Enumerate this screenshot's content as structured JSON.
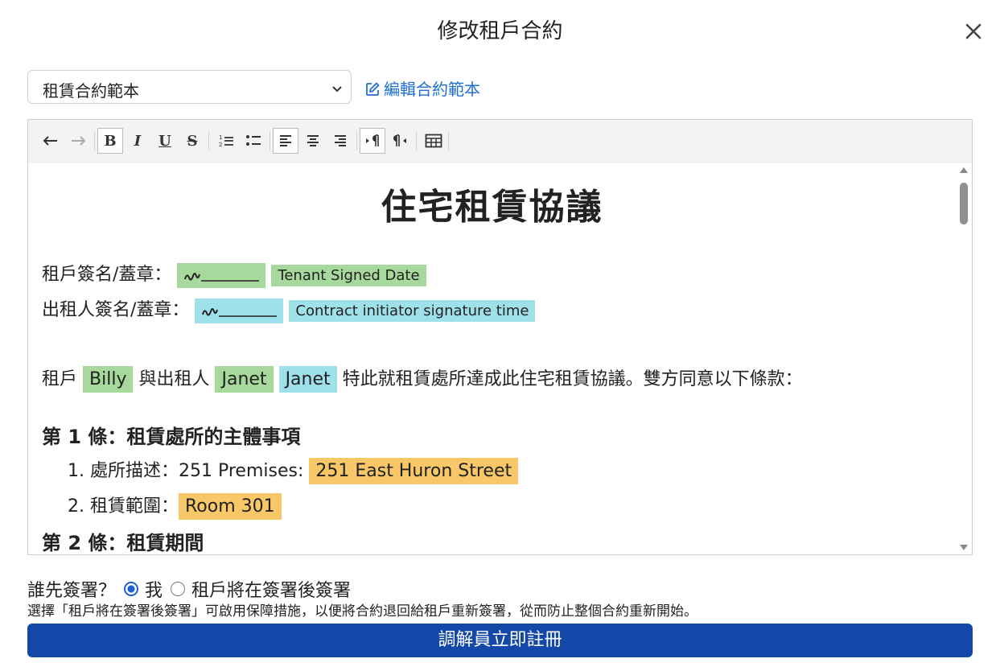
{
  "dialog": {
    "title": "修改租戶合約",
    "close_icon": "close-icon"
  },
  "template_select": {
    "value": "租賃合約範本"
  },
  "edit_template_link": {
    "label": "編輯合約範本",
    "icon": "pencil-square-icon"
  },
  "toolbar": {
    "icons": [
      "undo-icon",
      "redo-icon",
      "bold-icon",
      "italic-icon",
      "underline-icon",
      "strikethrough-icon",
      "ordered-list-icon",
      "bullet-list-icon",
      "align-left-icon",
      "align-center-icon",
      "align-right-icon",
      "ltr-icon",
      "rtl-icon",
      "table-icon"
    ],
    "bold": "B",
    "italic": "I",
    "underline": "U",
    "strike": "S"
  },
  "document": {
    "title": "住宅租賃協議",
    "tenant_sign_label": "租戶簽名/蓋章：",
    "tenant_signed_date": "Tenant Signed Date",
    "landlord_sign_label": "出租人簽名/蓋章：",
    "initiator_signature_time": "Contract initiator signature time",
    "intro": {
      "prefix": "租戶",
      "tenant_name": "Billy",
      "mid": "與出租人",
      "landlord_name_1": "Janet",
      "landlord_name_2": "Janet",
      "suffix": "特此就租賃處所達成此住宅租賃協議。雙方同意以下條款："
    },
    "article_1": "第 1 條：租賃處所的主體事項",
    "item_1_label": "1. 處所描述：251 Premises:",
    "item_1_value": "251 East Huron Street",
    "item_2_label": "2. 租賃範圍：",
    "item_2_value": "Room 301",
    "article_2": "第 2 條：租賃期間"
  },
  "signing_order": {
    "question": "誰先簽署？",
    "option_me": "我",
    "option_tenant": "租戶將在簽署後簽署",
    "selected": "我",
    "hint": "選擇「租戶將在簽署後簽署」可啟用保障措施，以便將合約退回給租戶重新簽署，從而防止整個合約重新開始。"
  },
  "primary_button": {
    "label": "調解員立即註冊"
  },
  "colors": {
    "accent_blue": "#1448a8",
    "link_blue": "#1f6fd1",
    "highlight_green": "#a6d99b",
    "highlight_cyan": "#9ee1ea",
    "highlight_orange": "#f7c768"
  }
}
